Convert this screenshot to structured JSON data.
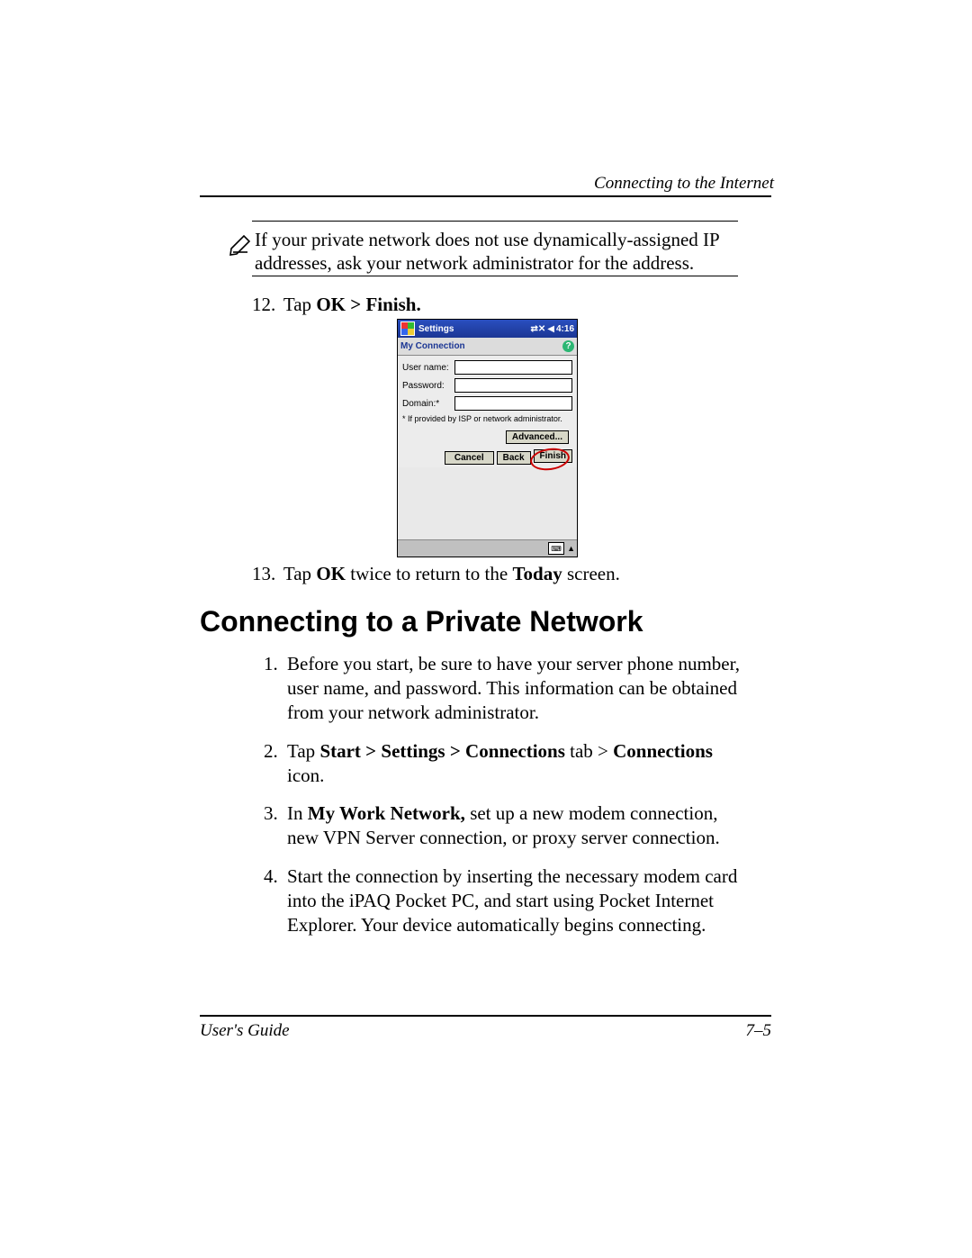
{
  "header": {
    "running_head": "Connecting to the Internet"
  },
  "note": {
    "text": "If your private network does not use dynamically-assigned IP addresses, ask your network administrator for the address."
  },
  "step12": {
    "number": "12.",
    "pre": "Tap ",
    "bold": "OK > Finish."
  },
  "pda": {
    "title": "Settings",
    "time": "4:16",
    "subtitle": "My Connection",
    "labels": {
      "user": "User name:",
      "pass": "Password:",
      "domain": "Domain:*"
    },
    "footnote": "* If provided by ISP or network administrator.",
    "buttons": {
      "advanced": "Advanced...",
      "cancel": "Cancel",
      "back": "Back",
      "finish": "Finish"
    }
  },
  "step13": {
    "number": "13.",
    "parts": [
      "Tap ",
      "OK",
      " twice to return to the ",
      "Today",
      " screen."
    ]
  },
  "heading": "Connecting to a Private Network",
  "list": {
    "i1": {
      "n": "1.",
      "t": "Before you start, be sure to have your server phone number, user name, and password. This information can be obtained from your network administrator."
    },
    "i2": {
      "n": "2.",
      "parts": [
        "Tap ",
        "Start > Settings > Connections",
        " tab > ",
        "Connections",
        " icon."
      ]
    },
    "i3": {
      "n": "3.",
      "parts": [
        "In ",
        "My Work Network,",
        " set up a new modem connection, new VPN Server connection, or proxy server connection."
      ]
    },
    "i4": {
      "n": "4.",
      "t": "Start the connection by inserting the necessary modem card into the iPAQ Pocket PC, and start using Pocket Internet Explorer. Your device automatically begins connecting."
    }
  },
  "footer": {
    "left": "User's Guide",
    "right": "7–5"
  }
}
